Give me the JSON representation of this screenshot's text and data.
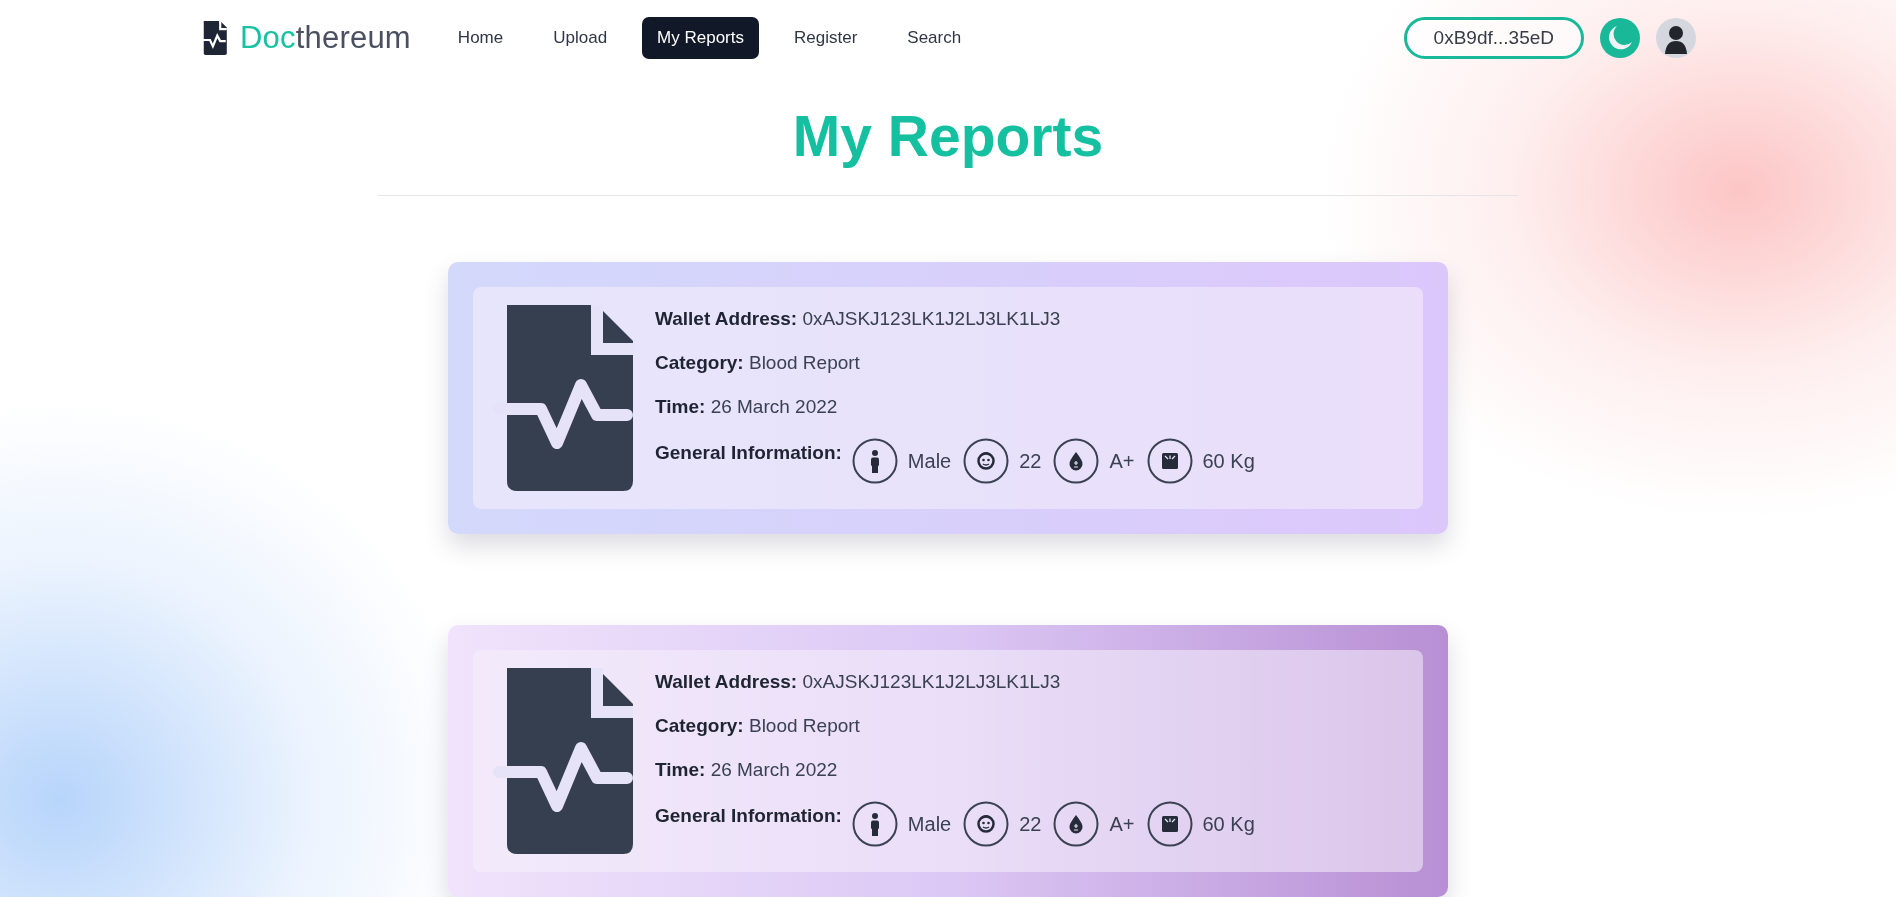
{
  "brand": {
    "first": "Doc",
    "rest": "thereum"
  },
  "nav": [
    {
      "label": "Home",
      "selected": false
    },
    {
      "label": "Upload",
      "selected": false
    },
    {
      "label": "My Reports",
      "selected": true
    },
    {
      "label": "Register",
      "selected": false
    },
    {
      "label": "Search",
      "selected": false
    }
  ],
  "wallet": "0xB9df...35eD",
  "title": "My Reports",
  "reports": [
    {
      "fields": [
        {
          "label": "Wallet Address:",
          "value": "0xAJSKJ123LK1J2LJ3LK1LJ3"
        },
        {
          "label": "Category:",
          "value": "Blood Report"
        },
        {
          "label": "Time:",
          "value": "26 March 2022"
        }
      ],
      "info_label": "General Information:",
      "info": [
        {
          "kind": "gender",
          "value": "Male"
        },
        {
          "kind": "age",
          "value": "22"
        },
        {
          "kind": "blood",
          "value": "A+"
        },
        {
          "kind": "weight",
          "value": "60 Kg"
        }
      ]
    },
    {
      "fields": [
        {
          "label": "Wallet Address:",
          "value": "0xAJSKJ123LK1J2LJ3LK1LJ3"
        },
        {
          "label": "Category:",
          "value": "Blood Report"
        },
        {
          "label": "Time:",
          "value": "26 March 2022"
        }
      ],
      "info_label": "General Information:",
      "info": [
        {
          "kind": "gender",
          "value": "Male"
        },
        {
          "kind": "age",
          "value": "22"
        },
        {
          "kind": "blood",
          "value": "A+"
        },
        {
          "kind": "weight",
          "value": "60 Kg"
        }
      ]
    }
  ]
}
